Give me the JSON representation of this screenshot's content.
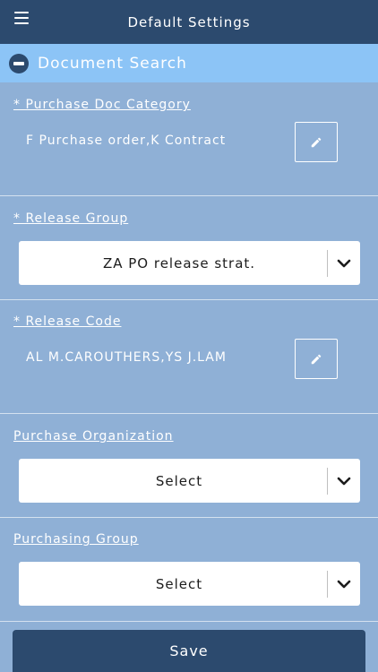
{
  "header": {
    "title": "Default Settings"
  },
  "section": {
    "title": "Document Search"
  },
  "fields": {
    "purchase_doc_category": {
      "label": "* Purchase Doc Category",
      "value": "F Purchase order,K Contract"
    },
    "release_group": {
      "label": "* Release Group",
      "value": "ZA PO release strat."
    },
    "release_code": {
      "label": "* Release Code",
      "value": "AL M.CAROUTHERS,YS J.LAM"
    },
    "purchase_organization": {
      "label": "Purchase Organization",
      "value": "Select"
    },
    "purchasing_group": {
      "label": "Purchasing Group",
      "value": "Select"
    }
  },
  "actions": {
    "save_label": "Save"
  },
  "colors": {
    "header": "#2c4a6e",
    "section_bar": "#8cc4f6",
    "background": "#8fb0d6",
    "button": "#2c4a6e"
  },
  "icons": {
    "menu": "hamburger-menu-icon",
    "collapse": "minus-circle-icon",
    "edit": "pencil-icon",
    "dropdown": "chevron-down-icon"
  }
}
